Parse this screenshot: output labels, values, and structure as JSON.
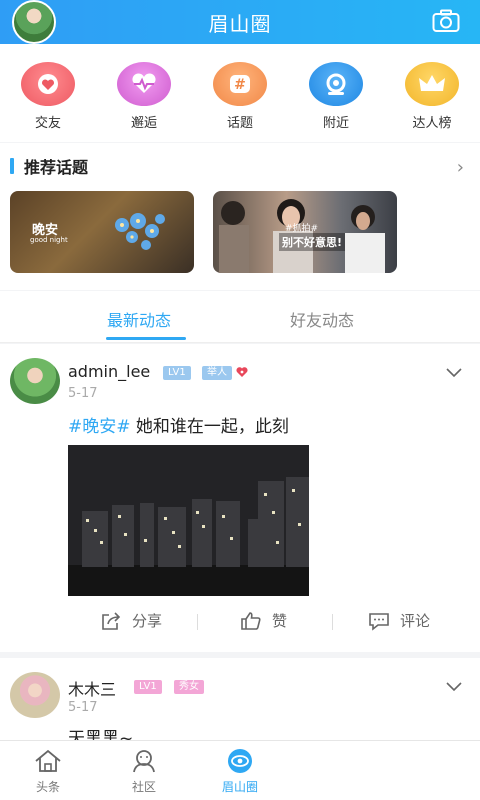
{
  "header": {
    "title": "眉山圈"
  },
  "categories": [
    {
      "label": "交友",
      "icon": "heart-icon",
      "color": "#f0626b"
    },
    {
      "label": "邂逅",
      "icon": "heartbeat-icon",
      "color": "#d96bd8"
    },
    {
      "label": "话题",
      "icon": "hashtag-icon",
      "color": "#f4975a"
    },
    {
      "label": "附近",
      "icon": "location-icon",
      "color": "#2f98ee"
    },
    {
      "label": "达人榜",
      "icon": "crown-icon",
      "color": "#f4c03b"
    }
  ],
  "topics": {
    "title": "推荐话题",
    "cards": [
      {
        "caption": "晚安",
        "subcaption": "good night"
      },
      {
        "tag": "#抓拍#",
        "caption": "别不好意思!"
      }
    ]
  },
  "tabs": {
    "active": "最新动态",
    "inactive": "好友动态"
  },
  "posts": [
    {
      "username": "admin_lee",
      "level": "LV1",
      "title_badge": "举人",
      "date": "5-17",
      "hashtag": "#晚安#",
      "text": " 她和谁在一起，此刻",
      "actions": {
        "share": "分享",
        "like": "赞",
        "comment": "评论"
      }
    },
    {
      "username": "木木三",
      "level": "LV1",
      "title_badge": "秀女",
      "date": "5-17",
      "text": "天黑黑~"
    }
  ],
  "nav": [
    {
      "label": "头条",
      "icon": "home-icon"
    },
    {
      "label": "社区",
      "icon": "community-icon"
    },
    {
      "label": "眉山圈",
      "icon": "circle-eye-icon",
      "active": true
    }
  ],
  "colors": {
    "accent": "#2fa8f3"
  }
}
